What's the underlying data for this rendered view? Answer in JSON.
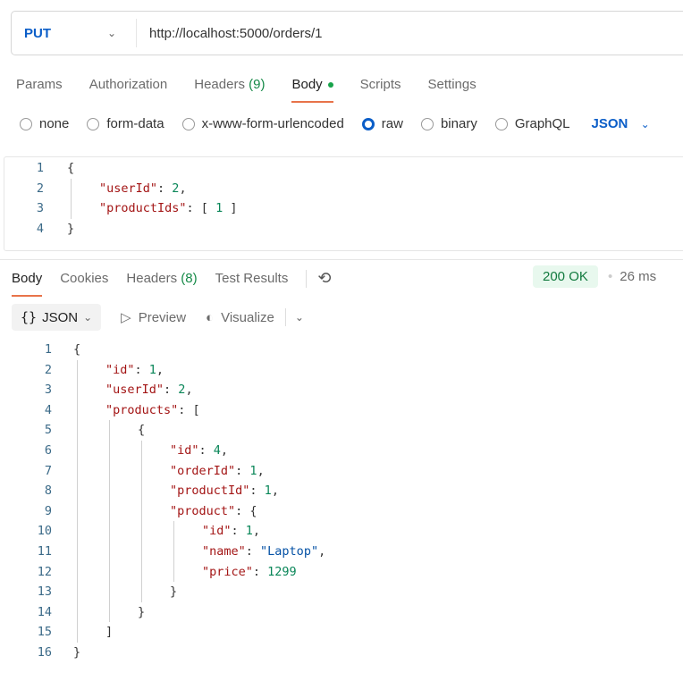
{
  "request": {
    "method": "PUT",
    "url": "http://localhost:5000/orders/1"
  },
  "tabs": [
    {
      "label": "Params"
    },
    {
      "label": "Authorization"
    },
    {
      "label": "Headers",
      "count": "(9)"
    },
    {
      "label": "Body",
      "active": true
    },
    {
      "label": "Scripts"
    },
    {
      "label": "Settings"
    }
  ],
  "body_types": [
    {
      "label": "none"
    },
    {
      "label": "form-data"
    },
    {
      "label": "x-www-form-urlencoded"
    },
    {
      "label": "raw",
      "selected": true
    },
    {
      "label": "binary"
    },
    {
      "label": "GraphQL"
    }
  ],
  "body_format": "JSON",
  "request_body": [
    {
      "n": "1",
      "i": 0,
      "t": [
        [
          "p",
          "{"
        ]
      ]
    },
    {
      "n": "2",
      "i": 1,
      "t": [
        [
          "key",
          "\"userId\""
        ],
        [
          "p",
          ": "
        ],
        [
          "num",
          "2"
        ],
        [
          "p",
          ","
        ]
      ]
    },
    {
      "n": "3",
      "i": 1,
      "t": [
        [
          "key",
          "\"productIds\""
        ],
        [
          "p",
          ": [ "
        ],
        [
          "num",
          "1"
        ],
        [
          "p",
          " ]"
        ]
      ]
    },
    {
      "n": "4",
      "i": 0,
      "t": [
        [
          "p",
          "}"
        ]
      ]
    }
  ],
  "response_tabs": [
    {
      "label": "Body",
      "active": true
    },
    {
      "label": "Cookies"
    },
    {
      "label": "Headers",
      "count": "(8)"
    },
    {
      "label": "Test Results"
    }
  ],
  "status": "200 OK",
  "time": "26 ms",
  "response_tools": {
    "format": "JSON",
    "preview": "Preview",
    "visualize": "Visualize"
  },
  "icons": {
    "history": "history-icon",
    "braces": "braces-icon",
    "play": "play-icon",
    "visualize": "visualize-icon"
  },
  "colors": {
    "accent": "#0b5ec8",
    "tab_underline": "#e8734a",
    "status_bg": "#e8f8ee",
    "status_text": "#117a3e"
  },
  "response_body": [
    {
      "n": "1",
      "i": 0,
      "t": [
        [
          "p",
          "{"
        ]
      ]
    },
    {
      "n": "2",
      "i": 1,
      "t": [
        [
          "key",
          "\"id\""
        ],
        [
          "p",
          ": "
        ],
        [
          "num",
          "1"
        ],
        [
          "p",
          ","
        ]
      ]
    },
    {
      "n": "3",
      "i": 1,
      "t": [
        [
          "key",
          "\"userId\""
        ],
        [
          "p",
          ": "
        ],
        [
          "num",
          "2"
        ],
        [
          "p",
          ","
        ]
      ]
    },
    {
      "n": "4",
      "i": 1,
      "t": [
        [
          "key",
          "\"products\""
        ],
        [
          "p",
          ": ["
        ]
      ]
    },
    {
      "n": "5",
      "i": 2,
      "t": [
        [
          "p",
          "{"
        ]
      ]
    },
    {
      "n": "6",
      "i": 3,
      "t": [
        [
          "key",
          "\"id\""
        ],
        [
          "p",
          ": "
        ],
        [
          "num",
          "4"
        ],
        [
          "p",
          ","
        ]
      ]
    },
    {
      "n": "7",
      "i": 3,
      "t": [
        [
          "key",
          "\"orderId\""
        ],
        [
          "p",
          ": "
        ],
        [
          "num",
          "1"
        ],
        [
          "p",
          ","
        ]
      ]
    },
    {
      "n": "8",
      "i": 3,
      "t": [
        [
          "key",
          "\"productId\""
        ],
        [
          "p",
          ": "
        ],
        [
          "num",
          "1"
        ],
        [
          "p",
          ","
        ]
      ]
    },
    {
      "n": "9",
      "i": 3,
      "t": [
        [
          "key",
          "\"product\""
        ],
        [
          "p",
          ": {"
        ]
      ]
    },
    {
      "n": "10",
      "i": 4,
      "t": [
        [
          "key",
          "\"id\""
        ],
        [
          "p",
          ": "
        ],
        [
          "num",
          "1"
        ],
        [
          "p",
          ","
        ]
      ]
    },
    {
      "n": "11",
      "i": 4,
      "t": [
        [
          "key",
          "\"name\""
        ],
        [
          "p",
          ": "
        ],
        [
          "str",
          "\"Laptop\""
        ],
        [
          "p",
          ","
        ]
      ]
    },
    {
      "n": "12",
      "i": 4,
      "t": [
        [
          "key",
          "\"price\""
        ],
        [
          "p",
          ": "
        ],
        [
          "num",
          "1299"
        ]
      ]
    },
    {
      "n": "13",
      "i": 3,
      "t": [
        [
          "p",
          "}"
        ]
      ]
    },
    {
      "n": "14",
      "i": 2,
      "t": [
        [
          "p",
          "}"
        ]
      ]
    },
    {
      "n": "15",
      "i": 1,
      "t": [
        [
          "p",
          "]"
        ]
      ]
    },
    {
      "n": "16",
      "i": 0,
      "t": [
        [
          "p",
          "}"
        ]
      ]
    }
  ]
}
